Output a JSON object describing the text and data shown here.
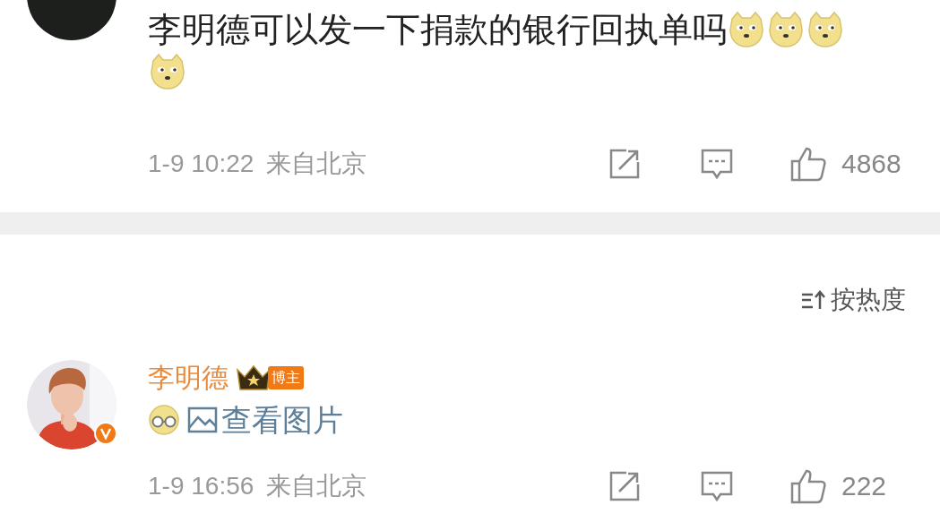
{
  "comments": [
    {
      "avatar": {
        "kind": "plain"
      },
      "verified": false,
      "content": [
        {
          "kind": "text",
          "text": "李明德可以发一下捐款的银行回执单吗"
        },
        {
          "kind": "dog-emoji"
        },
        {
          "kind": "dog-emoji"
        },
        {
          "kind": "dog-emoji"
        },
        {
          "kind": "break"
        },
        {
          "kind": "dog-emoji"
        }
      ],
      "time": "1-9 10:22",
      "location": "来自北京",
      "likes": "4868"
    },
    {
      "verified": true,
      "author": {
        "name": "李明德",
        "badge": "博主"
      },
      "content": [
        {
          "kind": "glasses-emoji"
        },
        {
          "kind": "image-link",
          "text": "查看图片"
        }
      ],
      "time": "1-9 16:56",
      "location": "来自北京",
      "likes": "222"
    }
  ],
  "sort": {
    "label": "按热度"
  }
}
